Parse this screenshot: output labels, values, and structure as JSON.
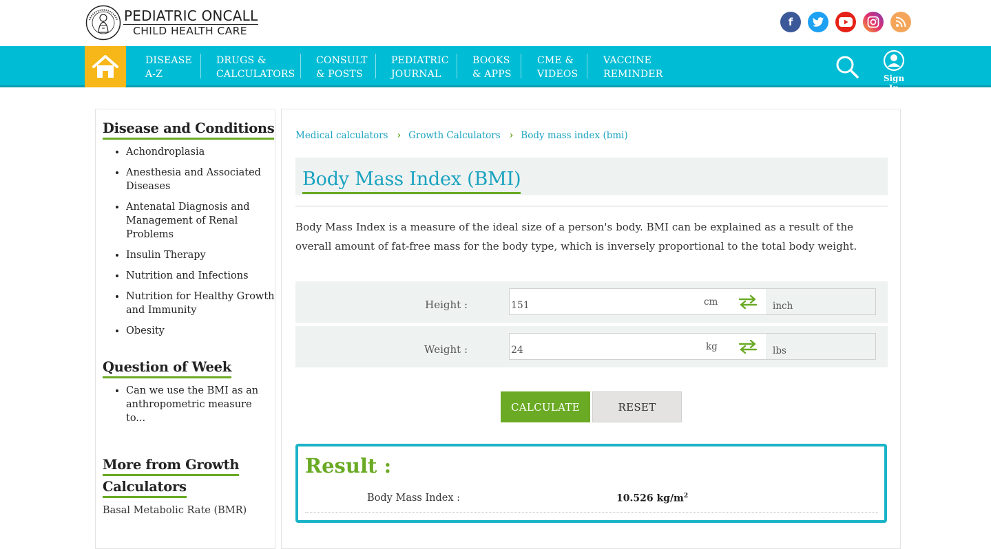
{
  "brand": {
    "line1": "PEDIATRIC ONCALL",
    "line2": "CHILD HEALTH CARE",
    "seal_text": "PEDIATRIC ONCALL CHILD HEALTH CARE"
  },
  "social": [
    {
      "name": "facebook",
      "glyph": "f"
    },
    {
      "name": "twitter",
      "glyph": "t"
    },
    {
      "name": "youtube",
      "glyph": "▶"
    },
    {
      "name": "instagram",
      "glyph": "◎"
    },
    {
      "name": "rss",
      "glyph": "☰"
    }
  ],
  "nav": {
    "items": [
      {
        "line1": "DISEASE",
        "line2": "A-Z"
      },
      {
        "line1": "DRUGS &",
        "line2": "CALCULATORS"
      },
      {
        "line1": "CONSULT",
        "line2": "& POSTS"
      },
      {
        "line1": "PEDIATRIC",
        "line2": "JOURNAL"
      },
      {
        "line1": "BOOKS",
        "line2": "& APPS"
      },
      {
        "line1": "CME &",
        "line2": "VIDEOS"
      },
      {
        "line1": "VACCINE",
        "line2": "REMINDER"
      }
    ],
    "sign_in": "Sign In"
  },
  "sidebar": {
    "section1": {
      "title": "Disease and Conditions",
      "items": [
        "Achondroplasia",
        "Anesthesia and Associated Diseases",
        "Antenatal Diagnosis and Management of Renal Problems",
        "Insulin Therapy",
        "Nutrition and Infections",
        "Nutrition for Healthy Growth and Immunity",
        "Obesity"
      ]
    },
    "section2": {
      "title": "Question of Week",
      "items": [
        "Can we use the BMI as an anthropometric measure to..."
      ]
    },
    "section3": {
      "title_line1": "More from Growth",
      "title_line2": "Calculators",
      "first_link": "Basal Metabolic Rate (BMR)"
    }
  },
  "breadcrumb": [
    "Medical calculators",
    "Growth Calculators",
    "Body mass index (bmi)"
  ],
  "page": {
    "title": "Body Mass Index (BMI)",
    "description": "Body Mass Index is a measure of the ideal size of a person's body. BMI can be explained as a result of the overall amount of fat-free mass for the body type, which is inversely proportional to the total body weight."
  },
  "form": {
    "height": {
      "label": "Height  :",
      "value": "151",
      "unit_primary": "cm",
      "unit_alt": "inch"
    },
    "weight": {
      "label": "Weight  :",
      "value": "24",
      "unit_primary": "kg",
      "unit_alt": "lbs"
    },
    "calculate_label": "CALCULATE",
    "reset_label": "RESET"
  },
  "result": {
    "heading": "Result :",
    "label": "Body Mass Index :",
    "value": "10.526 kg/m",
    "unit_sup": "2"
  },
  "colors": {
    "nav_bg": "#00bcd4",
    "home_bg": "#f7b718",
    "accent_green": "#6aaa24",
    "link_blue": "#1aa3c0",
    "panel_bg": "#eef2f1",
    "result_border": "#1ab3c8"
  }
}
